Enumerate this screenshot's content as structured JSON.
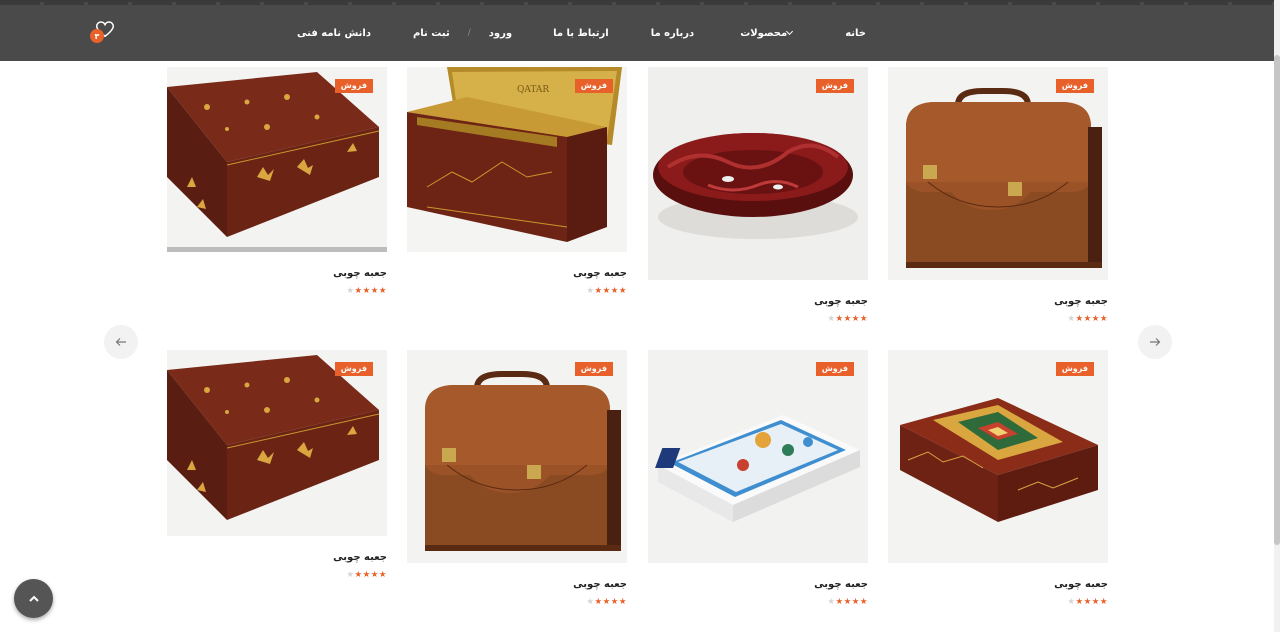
{
  "nav": {
    "home": "خانه",
    "products": "محصولات",
    "about": "درباره ما",
    "contact": "ارتباط با ما",
    "login": "ورود",
    "separator": "/",
    "register": "ثبت نام",
    "knowledge": "دانش نامه فنی"
  },
  "wishlist": {
    "count": "۳",
    "icon": "heart-icon"
  },
  "colors": {
    "header": "#4a4a4a",
    "accent": "#e8612a"
  },
  "products": [
    {
      "title": "جعبه چوبی",
      "badge": "فروش",
      "rating": 4,
      "max_rating": 5,
      "image": "painted-wooden-box"
    },
    {
      "title": "جعبه چوبی",
      "badge": "فروش",
      "rating": 4,
      "max_rating": 5,
      "image": "open-wooden-box-gold-lining"
    },
    {
      "title": "جعبه چوبی",
      "badge": "فروش",
      "rating": 4,
      "max_rating": 5,
      "image": "red-wooden-bowl"
    },
    {
      "title": "جعبه چوبی",
      "badge": "فروش",
      "rating": 4,
      "max_rating": 5,
      "image": "leather-briefcase-box"
    },
    {
      "title": "جعبه چوبی",
      "badge": "فروش",
      "rating": 4,
      "max_rating": 5,
      "image": "painted-wooden-box"
    },
    {
      "title": "جعبه چوبی",
      "badge": "فروش",
      "rating": 4,
      "max_rating": 5,
      "image": "leather-briefcase-box"
    },
    {
      "title": "جعبه چوبی",
      "badge": "فروش",
      "rating": 4,
      "max_rating": 5,
      "image": "white-tile-box"
    },
    {
      "title": "جعبه چوبی",
      "badge": "فروش",
      "rating": 4,
      "max_rating": 5,
      "image": "patterned-wooden-box"
    }
  ]
}
